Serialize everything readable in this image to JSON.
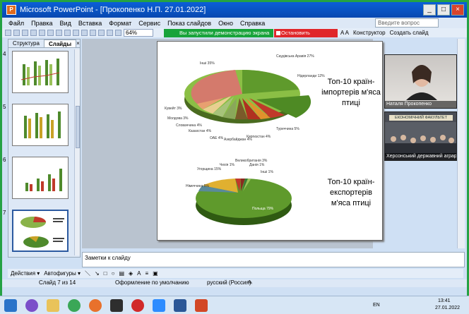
{
  "window": {
    "title": "Microsoft PowerPoint - [Прокопенко Н.П. 27.01.2022]",
    "app_icon_letter": "P",
    "btn_min": "_",
    "btn_max": "□",
    "btn_close": "×"
  },
  "menu": {
    "items": [
      "Файл",
      "Правка",
      "Вид",
      "Вставка",
      "Формат",
      "Сервис",
      "Показ слайдов",
      "Окно",
      "Справка"
    ],
    "ask_placeholder": "Введите вопрос"
  },
  "toolbar": {
    "zoom": "64%",
    "share_status": "Вы запустили демонстрацию экрана",
    "stop_share": "Остановить демонстрацию",
    "designer": "Конструктор",
    "new_slide": "Создать слайд"
  },
  "panel": {
    "tab_outline": "Структура",
    "tab_slides": "Слайды",
    "close": "×",
    "slide_numbers": [
      "4",
      "5",
      "6",
      "7"
    ]
  },
  "slide": {
    "import_title": "Топ-10 країн-імпортерів м'яса птиці",
    "export_title": "Топ-10 країн-експортерів м'яса птиці",
    "import_labels": [
      "Саудівська Аравія 27%",
      "Нідерланди 12%",
      "Туреччина 5%",
      "Киргизстан 4%",
      "Азербайджан 4%",
      "ОАЕ 4%",
      "Казахстан 4%",
      "Словаччина 4%",
      "Молдова 3%",
      "Кувейт 3%",
      "Інші 35%"
    ],
    "export_labels": [
      "Польща 79%",
      "Німеччина 5%",
      "Угорщина 15%",
      "Чехія 1%",
      "Великобританія 3%",
      "Данія 1%",
      "Інші 1%"
    ]
  },
  "chart_data": [
    {
      "type": "pie",
      "title": "",
      "labels": [
        "Саудівська Аравія",
        "Нідерланди",
        "Туреччина",
        "Киргизстан",
        "Азербайджан",
        "ОАЕ",
        "Казахстан",
        "Словаччина",
        "Молдова",
        "Кувейт",
        "Інші"
      ],
      "values": [
        27,
        12,
        5,
        4,
        4,
        4,
        4,
        4,
        3,
        3,
        35
      ]
    },
    {
      "type": "pie",
      "title": "",
      "labels": [
        "Польща",
        "Німеччина",
        "Угорщина",
        "Чехія",
        "Великобританія",
        "Данія",
        "Інші"
      ],
      "values": [
        79,
        5,
        15,
        1,
        3,
        1,
        1
      ]
    }
  ],
  "notes": {
    "placeholder": "Заметки к слайду"
  },
  "drawbar": {
    "actions": "Действия ▾",
    "autoshapes": "Автофигуры ▾"
  },
  "status": {
    "slide": "Слайд 7 из 14",
    "design": "Оформление по умолчанию",
    "language": "русский (Россия)"
  },
  "video": {
    "person1": "Наталя Прокопенко",
    "person2": "Херсонський державний аграрно...",
    "banner": "ЕКОНОМІЧНИЙ ФАКУЛЬТЕТ"
  },
  "taskbar": {
    "lang": "EN",
    "time": "13:41",
    "date": "27.01.2022"
  },
  "colors": {
    "share_green": "#18a33a",
    "stop_red": "#e0262a",
    "title_blue": "#0a5fd8",
    "frame_green": "#25a244"
  }
}
